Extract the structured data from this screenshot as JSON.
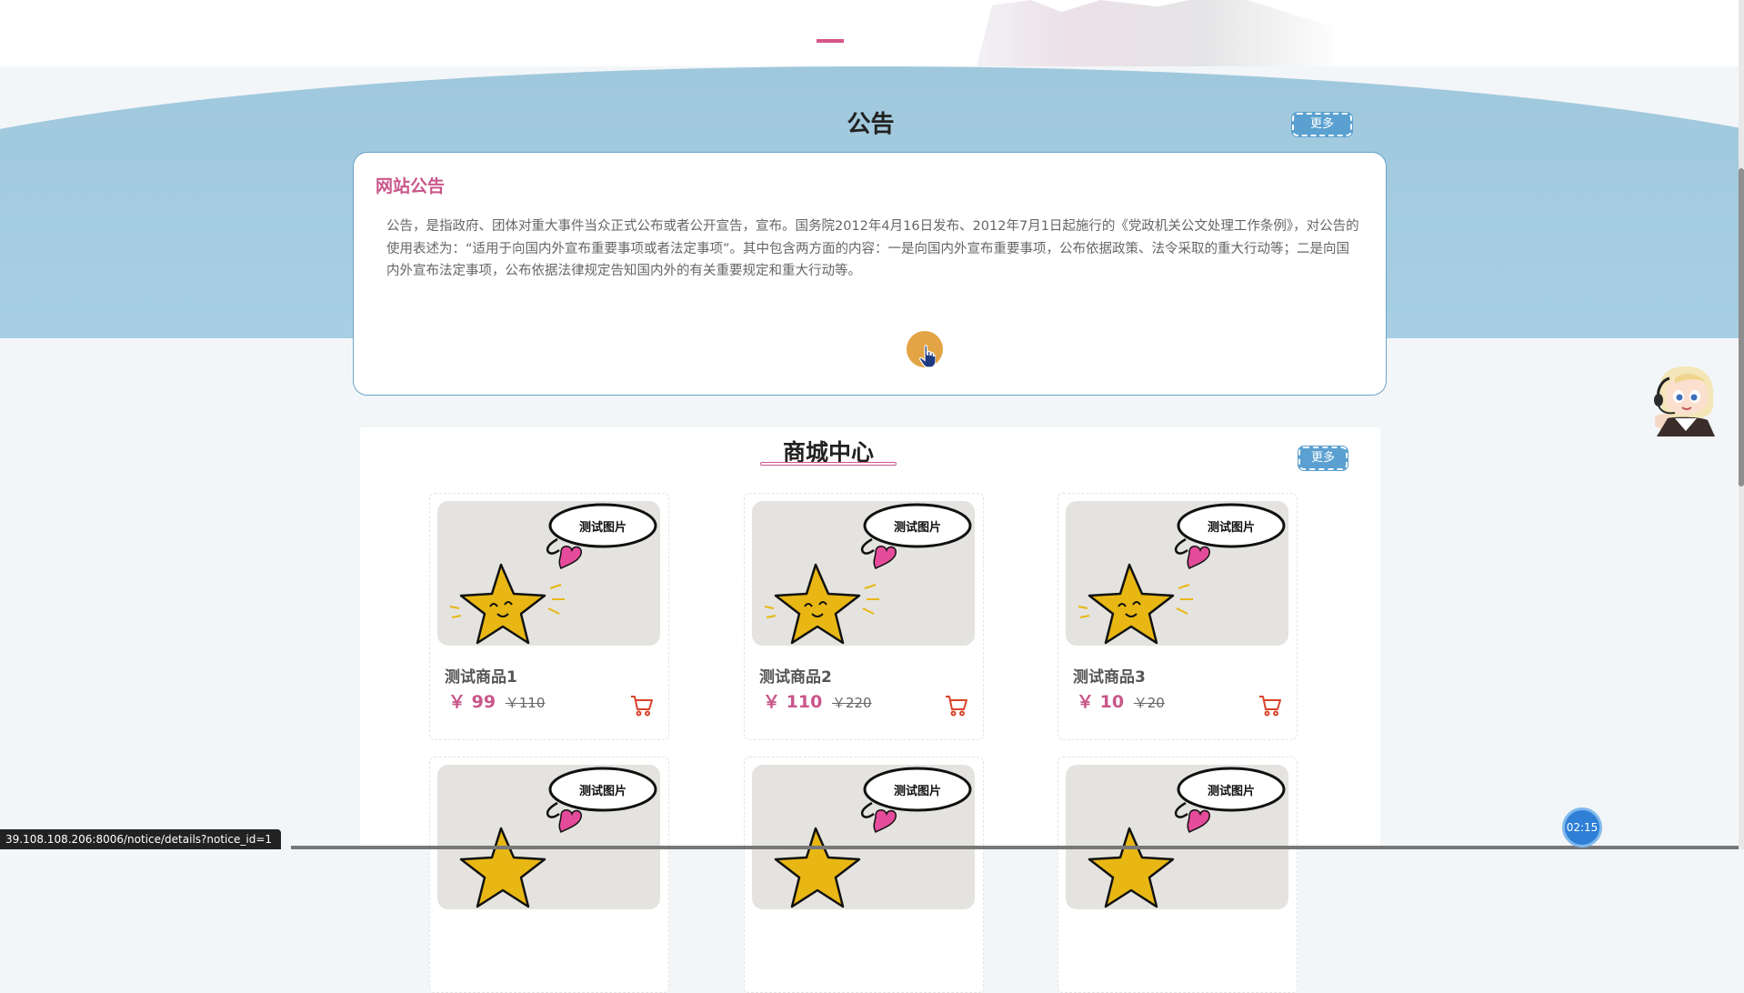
{
  "notice": {
    "section_title": "公告",
    "more_label": "更多",
    "card_title": "网站公告",
    "body": "公告，是指政府、团体对重大事件当众正式公布或者公开宣告，宣布。国务院2012年4月16日发布、2012年7月1日起施行的《党政机关公文处理工作条例》，对公告的使用表述为：“适用于向国内外宣布重要事项或者法定事项”。其中包含两方面的内容：一是向国内外宣布重要事项，公布依据政策、法令采取的重大行动等；二是向国内外宣布法定事项，公布依据法律规定告知国内外的有关重要规定和重大行动等。"
  },
  "shop": {
    "section_title": "商城中心",
    "more_label": "更多",
    "image_caption": "测试图片",
    "currency": "￥",
    "products": [
      {
        "name": "测试商品1",
        "price": "99",
        "old_price": "110"
      },
      {
        "name": "测试商品2",
        "price": "110",
        "old_price": "220"
      },
      {
        "name": "测试商品3",
        "price": "10",
        "old_price": "20"
      }
    ]
  },
  "status_bar": {
    "url": "39.108.108.206:8006/notice/details?notice_id=1"
  },
  "timer": {
    "label": "02:15"
  },
  "icons": {
    "cart": "shopping-cart-icon",
    "cursor": "hand-pointer-icon",
    "assistant": "assistant-avatar"
  },
  "colors": {
    "accent_pink": "#c9568a",
    "band_blue": "#a6cde2",
    "button_blue": "#5aa0d0",
    "cart_red": "#d9442b",
    "notice_dot": "#e2a444"
  }
}
